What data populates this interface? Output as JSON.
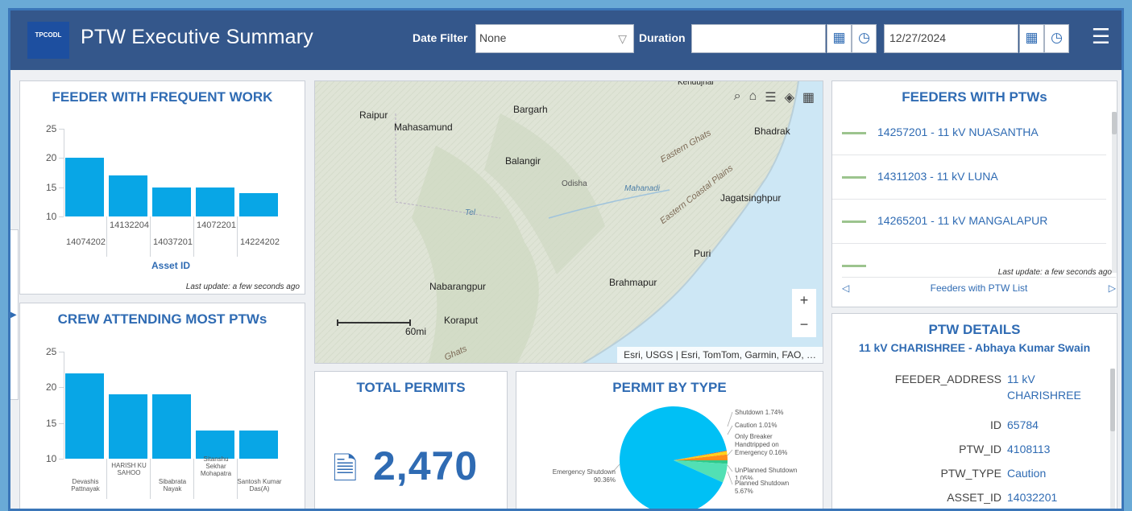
{
  "header": {
    "logo_text": "TPCODL",
    "title": "PTW Executive Summary",
    "date_filter_label": "Date Filter",
    "date_filter_value": "None",
    "duration_label": "Duration",
    "duration_start": "",
    "duration_end": "12/27/2024"
  },
  "feeder_frequent": {
    "title": "FEEDER WITH FREQUENT WORK",
    "xlabel": "Asset ID",
    "last_update": "Last update: a few seconds ago",
    "chart_data": {
      "type": "bar",
      "categories": [
        "14074202",
        "14132204",
        "14037201",
        "14072201",
        "14224202"
      ],
      "values": [
        20,
        17,
        15,
        15,
        14
      ],
      "xlabel": "Asset ID",
      "ylim": [
        10,
        25
      ],
      "yticks": [
        "25",
        "20",
        "15",
        "10"
      ]
    }
  },
  "crew": {
    "title": "CREW ATTENDING MOST PTWs",
    "chart_data": {
      "type": "bar",
      "categories": [
        "Devashis Pattnayak",
        "HARISH KU SAHOO",
        "Sibabrata Nayak",
        "Sitanshu Sekhar Mohapatra",
        "Santosh Kumar Das(A)"
      ],
      "values": [
        22,
        19,
        19,
        14,
        14
      ],
      "ylim": [
        10,
        25
      ],
      "yticks": [
        "25",
        "20",
        "15",
        "10"
      ]
    }
  },
  "map": {
    "labels": [
      "Raipur",
      "Mahasamund",
      "Bargarh",
      "Bhadrak",
      "Balangir",
      "Odisha",
      "Eastern Ghats",
      "Mahanadi",
      "Eastern Coastal Plains",
      "Jagatsinghpur",
      "Tel",
      "Puri",
      "Nabarangpur",
      "Brahmapur",
      "Koraput",
      "Ghats",
      "Kendujhar"
    ],
    "scale": "60mi",
    "attribution": "Esri, USGS | Esri, TomTom, Garmin, FAO, …",
    "zoom_in": "+",
    "zoom_out": "−"
  },
  "total_permits": {
    "title": "TOTAL PERMITS",
    "value": "2,470"
  },
  "permit_type": {
    "title": "PERMIT BY TYPE",
    "chart_data": {
      "type": "pie",
      "slices": [
        {
          "label": "Emergency Shutdown",
          "value": 90.36,
          "color": "#00c0f5"
        },
        {
          "label": "Planned Shutdown",
          "value": 5.67,
          "color": "#52e0b4"
        },
        {
          "label": "UnPlanned Shutdown",
          "value": 1.05,
          "color": "#2fc98a"
        },
        {
          "label": "Shutdown",
          "value": 1.74,
          "color": "#ff8c1a"
        },
        {
          "label": "Caution",
          "value": 1.01,
          "color": "#ffd21a"
        },
        {
          "label": "Only Breaker Handtripped on Emergency",
          "value": 0.16,
          "color": "#d83a2a"
        }
      ]
    },
    "labels": {
      "shutdown": "Shutdown 1.74%",
      "caution": "Caution 1.01%",
      "breaker": "Only Breaker\nHandtripped on\nEmergency 0.16%",
      "unplanned": "UnPlanned Shutdown\n1.05%",
      "planned": "Planned Shutdown\n5.67%",
      "emergency": "Emergency Shutdown\n90.36%"
    }
  },
  "feeders_ptw": {
    "title": "FEEDERS WITH PTWs",
    "items": [
      "14257201 - 11 kV NUASANTHA",
      "14311203 - 11 kV LUNA",
      "14265201 - 11 kV MANGALAPUR"
    ],
    "last_update": "Last update: a few seconds ago",
    "pager_label": "Feeders with PTW List"
  },
  "ptw_details": {
    "title": "PTW DETAILS",
    "subtitle": "11 kV CHARISHREE - Abhaya Kumar Swain",
    "rows": [
      {
        "key": "FEEDER_ADDRESS",
        "value": "11 kV\nCHARISHREE"
      },
      {
        "key": "ID",
        "value": "65784"
      },
      {
        "key": "PTW_ID",
        "value": "4108113"
      },
      {
        "key": "PTW_TYPE",
        "value": "Caution"
      },
      {
        "key": "ASSET_ID",
        "value": "14032201"
      }
    ]
  }
}
